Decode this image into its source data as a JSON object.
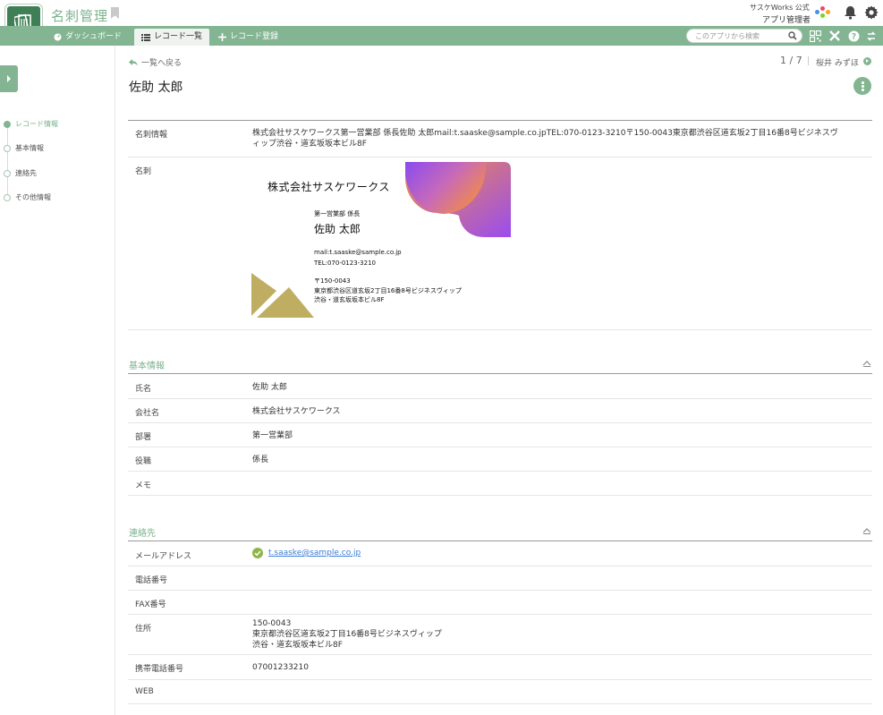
{
  "header": {
    "app_title": "名刺管理",
    "org_name": "サスケWorks 公式",
    "user_role": "アプリ管理者"
  },
  "nav": {
    "tabs": [
      {
        "label": "ダッシュボード"
      },
      {
        "label": "レコード一覧"
      },
      {
        "label": "レコード登録"
      }
    ],
    "search_placeholder": "このアプリから検索"
  },
  "sidebar": {
    "items": [
      {
        "label": "レコード情報"
      },
      {
        "label": "基本情報"
      },
      {
        "label": "連絡先"
      },
      {
        "label": "その他情報"
      }
    ]
  },
  "record": {
    "back_label": "一覧へ戻る",
    "pager": "1 / 7",
    "next_user": "桜井 みずほ",
    "name": "佐助 太郎"
  },
  "record_info": {
    "meishi_info_label": "名刺情報",
    "meishi_info_line1": "株式会社サスケワークス第一営業部 係長佐助 太郎mail:t.saaske@sample.co.jpTEL:070-0123-3210〒150-0043東京都渋谷区道玄坂2丁目16番8号ビジネスヴ",
    "meishi_info_line2": "ィップ渋谷・道玄坂坂本ビル8F",
    "card_label": "名刺"
  },
  "card": {
    "company": "株式会社サスケワークス",
    "dept": "第一営業部 係長",
    "person": "佐助 太郎",
    "mail": "mail:t.saaske@sample.co.jp",
    "tel": "TEL:070-0123-3210",
    "zip": "〒150-0043",
    "addr1": "東京都渋谷区道玄坂2丁目16番8号ビジネスヴィップ",
    "addr2": "渋谷・道玄坂坂本ビル8F"
  },
  "basic": {
    "title": "基本情報",
    "rows": [
      {
        "label": "氏名",
        "value": "佐助 太郎"
      },
      {
        "label": "会社名",
        "value": "株式会社サスケワークス"
      },
      {
        "label": "部署",
        "value": "第一営業部"
      },
      {
        "label": "役職",
        "value": "係長"
      },
      {
        "label": "メモ",
        "value": ""
      }
    ]
  },
  "contact": {
    "title": "連絡先",
    "email_label": "メールアドレス",
    "email": "t.saaske@sample.co.jp",
    "phone_label": "電話番号",
    "fax_label": "FAX番号",
    "address_label": "住所",
    "address_line1": "150-0043",
    "address_line2": "東京都渋谷区道玄坂2丁目16番8号ビジネスヴィップ",
    "address_line3": "渋谷・道玄坂坂本ビル8F",
    "mobile_label": "携帯電話番号",
    "mobile": "07001233210",
    "web_label": "WEB"
  },
  "colors": {
    "accent": "#83b592",
    "accent_text": "#7bb28d",
    "logo_bg": "#3f7f55",
    "link": "#3a7bd5",
    "card_gold": "#bfae62"
  }
}
